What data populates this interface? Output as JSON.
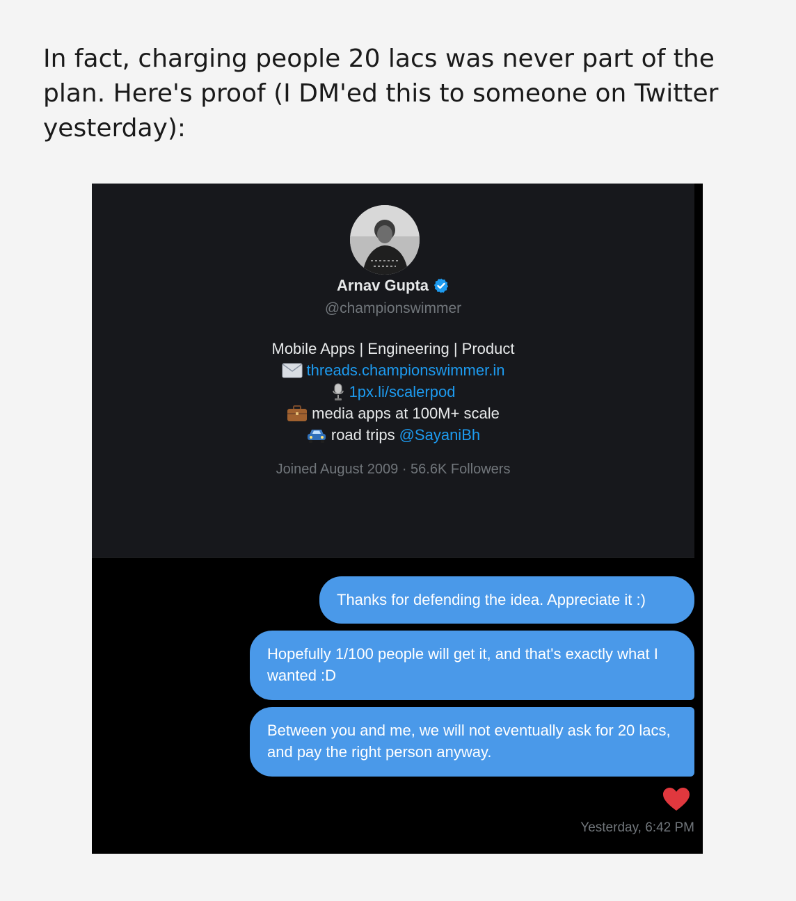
{
  "intro_text": "In fact, charging people 20 lacs was never part of the plan. Here's proof (I DM'ed this to someone on Twitter yesterday):",
  "profile": {
    "name": "Arnav Gupta",
    "handle": "@championswimmer",
    "bio_line1": "Mobile Apps | Engineering | Product",
    "bio_line2_link": "threads.championswimmer.in",
    "bio_line3_link": "1px.li/scalerpod",
    "bio_line4_text": "media apps at 100M+ scale",
    "bio_line5_text": "road trips",
    "bio_line5_link": "@SayaniBh",
    "meta": "Joined August 2009 · 56.6K Followers",
    "icons": {
      "verified": "verified-badge-icon",
      "envelope": "envelope-icon",
      "microphone": "microphone-icon",
      "briefcase": "briefcase-icon",
      "car": "car-icon"
    }
  },
  "messages": [
    {
      "text": "Thanks for defending the idea. Appreciate it :)"
    },
    {
      "text": "Hopefully 1/100 people will get it, and that's exactly what I wanted :D"
    },
    {
      "text": "Between you and me, we will not eventually ask for 20 lacs, and pay the right person anyway."
    }
  ],
  "reaction": "heart-icon",
  "timestamp": "Yesterday, 6:42 PM",
  "colors": {
    "page_bg": "#f4f4f4",
    "profile_bg": "#17181c",
    "chat_bg": "#000000",
    "bubble": "#4a99e9",
    "link": "#1d9bf0",
    "muted": "#71767b",
    "heart": "#e0383e"
  }
}
